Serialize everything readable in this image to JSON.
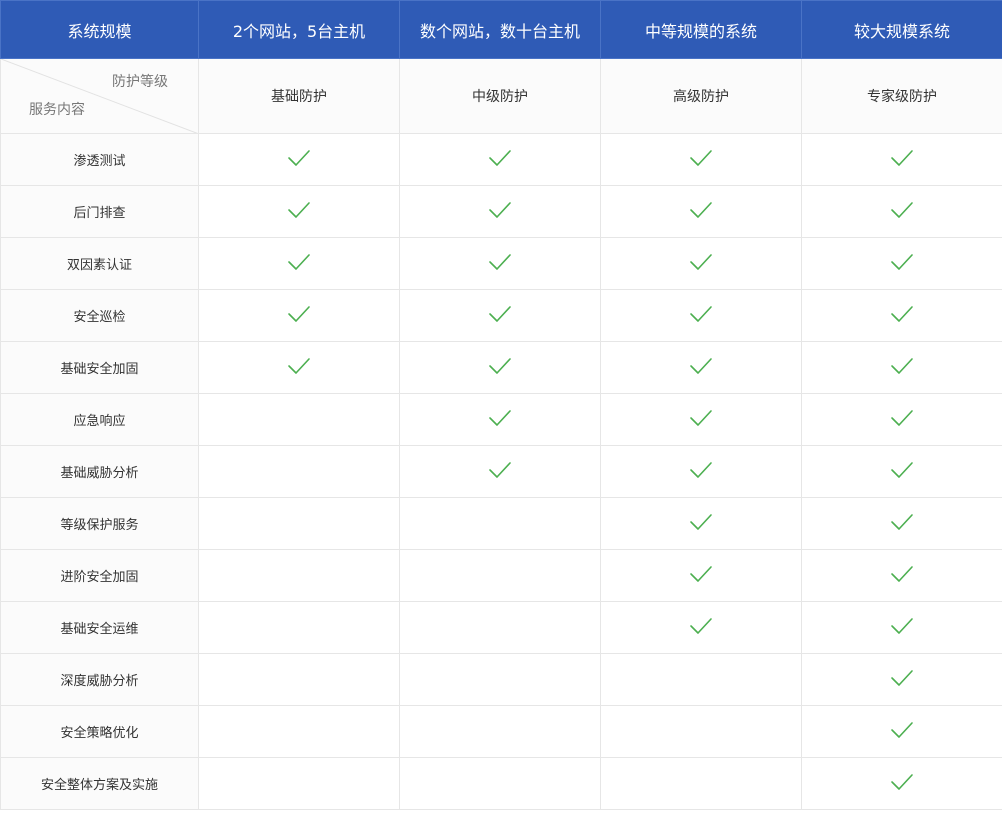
{
  "header": {
    "corner_label": "系统规模",
    "columns": [
      "2个网站，5台主机",
      "数个网站，数十台主机",
      "中等规模的系统",
      "较大规模系统"
    ]
  },
  "subheader": {
    "level_label": "防护等级",
    "service_label": "服务内容",
    "levels": [
      "基础防护",
      "中级防护",
      "高级防护",
      "专家级防护"
    ]
  },
  "check_color": "#4caf50",
  "rows": [
    {
      "name": "渗透测试",
      "checks": [
        true,
        true,
        true,
        true
      ]
    },
    {
      "name": "后门排查",
      "checks": [
        true,
        true,
        true,
        true
      ]
    },
    {
      "name": "双因素认证",
      "checks": [
        true,
        true,
        true,
        true
      ]
    },
    {
      "name": "安全巡检",
      "checks": [
        true,
        true,
        true,
        true
      ]
    },
    {
      "name": "基础安全加固",
      "checks": [
        true,
        true,
        true,
        true
      ]
    },
    {
      "name": "应急响应",
      "checks": [
        false,
        true,
        true,
        true
      ]
    },
    {
      "name": "基础威胁分析",
      "checks": [
        false,
        true,
        true,
        true
      ]
    },
    {
      "name": "等级保护服务",
      "checks": [
        false,
        false,
        true,
        true
      ]
    },
    {
      "name": "进阶安全加固",
      "checks": [
        false,
        false,
        true,
        true
      ]
    },
    {
      "name": "基础安全运维",
      "checks": [
        false,
        false,
        true,
        true
      ]
    },
    {
      "name": "深度威胁分析",
      "checks": [
        false,
        false,
        false,
        true
      ]
    },
    {
      "name": "安全策略优化",
      "checks": [
        false,
        false,
        false,
        true
      ]
    },
    {
      "name": "安全整体方案及实施",
      "checks": [
        false,
        false,
        false,
        true
      ]
    }
  ]
}
